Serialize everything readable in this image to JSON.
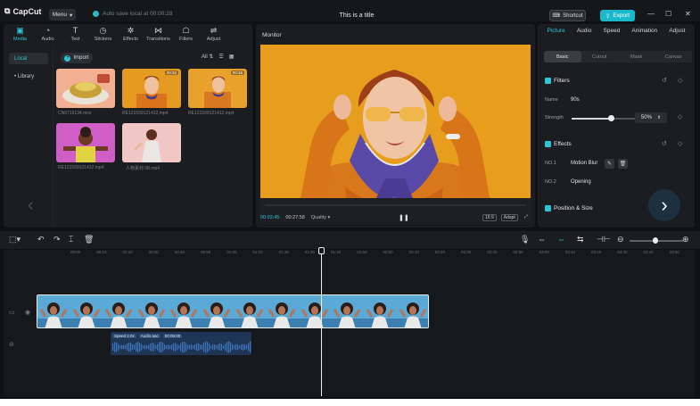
{
  "app": {
    "logo_text": "CapCut",
    "menu_label": "Menu",
    "autosave_text": "Auto save local at 00:00:28",
    "doc_title": "This is a title",
    "shortcut_label": "Shortcut",
    "export_label": "Export"
  },
  "media_toolbar": [
    {
      "label": "Media",
      "icon": "media-icon"
    },
    {
      "label": "Audio",
      "icon": "audio-icon"
    },
    {
      "label": "Text",
      "icon": "text-icon"
    },
    {
      "label": "Stickers",
      "icon": "stickers-icon"
    },
    {
      "label": "Effects",
      "icon": "effects-icon"
    },
    {
      "label": "Transitions",
      "icon": "transitions-icon"
    },
    {
      "label": "Filters",
      "icon": "filters-icon"
    },
    {
      "label": "Adjust",
      "icon": "adjust-icon"
    }
  ],
  "left_nav": {
    "local": "Local",
    "library": "• Library"
  },
  "import_label": "Import",
  "media_filter": "All",
  "thumbnails": [
    {
      "name": "CN0716134.mov",
      "duration": ""
    },
    {
      "name": "RE121509121412.mp4",
      "duration": "00:32"
    },
    {
      "name": "RE121509121412.mp4",
      "duration": "00:15"
    },
    {
      "name": "RE121509121412.mp4",
      "duration": ""
    },
    {
      "name": "人物素材 08.mp4",
      "duration": ""
    }
  ],
  "monitor": {
    "title": "Monitor",
    "current_time": "00:02:45",
    "total_time": "00:27:58",
    "quality_label": "Quality",
    "ratio_label": "16:9",
    "adapt_label": "Adapt"
  },
  "properties": {
    "tabs": [
      "Picture",
      "Audio",
      "Speed",
      "Animation",
      "Adjust"
    ],
    "sub_tabs": [
      "Basic",
      "Cutout",
      "Mask",
      "Canvas"
    ],
    "filters_title": "Filters",
    "name_label": "Name",
    "name_value": "90s",
    "strength_label": "Strength",
    "strength_value": "50%",
    "strength_fraction": 0.6,
    "effects_title": "Effects",
    "effect1_label": "NO.1",
    "effect1_value": "Motion Blur",
    "effect2_label": "NO.2",
    "effect2_value": "Opening",
    "position_title": "Position & Size"
  },
  "timeline": {
    "ruler": [
      "00:00",
      "00:10",
      "00:20",
      "00:30",
      "00:40",
      "00:50",
      "01:00",
      "01:10",
      "01:20",
      "01:30",
      "01:40",
      "01:50",
      "02:00",
      "02:10",
      "02:20",
      "02:30",
      "02:40",
      "02:50",
      "03:00",
      "03:10",
      "03:20",
      "03:30",
      "03:40",
      "03:50"
    ],
    "audio_tags": [
      "Speed 2.0x",
      "Audio.aac",
      "00:05:00"
    ]
  },
  "colors": {
    "accent": "#2ec5d8",
    "background": "#0f1115",
    "panel": "#1b1d21"
  }
}
